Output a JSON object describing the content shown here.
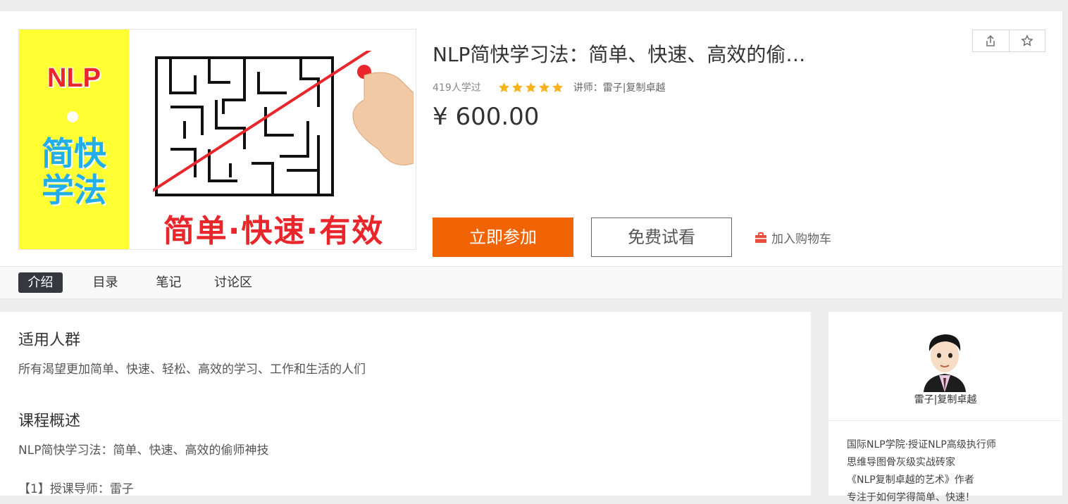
{
  "course": {
    "cover": {
      "brand_text": "NLP",
      "side_text": "简快学法",
      "bottom_text": "简单·快速·有效"
    },
    "title": "NLP简快学习法：简单、快速、高效的偷…",
    "learners": "419人学过",
    "rating": 5,
    "teacher_label": "讲师：雷子|复制卓越",
    "price": "¥ 600.00",
    "join_label": "立即参加",
    "trial_label": "免费试看",
    "cart_label": "加入购物车"
  },
  "tabs": [
    {
      "label": "介绍",
      "active": true
    },
    {
      "label": "目录",
      "active": false
    },
    {
      "label": "笔记",
      "active": false
    },
    {
      "label": "讨论区",
      "active": false
    }
  ],
  "intro": {
    "audience_heading": "适用人群",
    "audience_text": "所有渴望更加简单、快速、轻松、高效的学习、工作和生活的人们",
    "overview_heading": "课程概述",
    "overview_text": "NLP简快学习法：简单、快速、高效的偷师神技",
    "overview_item": "【1】授课导师：雷子"
  },
  "teacher": {
    "name": "雷子|复制卓越",
    "bio": [
      "国际NLP学院·授证NLP高级执行师",
      "思维导图骨灰级实战砖家",
      "《NLP复制卓越的艺术》作者",
      "专注于如何学得简单、快速！"
    ]
  },
  "colors": {
    "accent": "#f06405",
    "star": "#f6b21b",
    "cart_icon": "#e84c3d",
    "tab_active": "#35393f"
  },
  "icons": {
    "share": "share-icon",
    "favorite": "star-outline-icon",
    "cart": "cart-icon"
  }
}
